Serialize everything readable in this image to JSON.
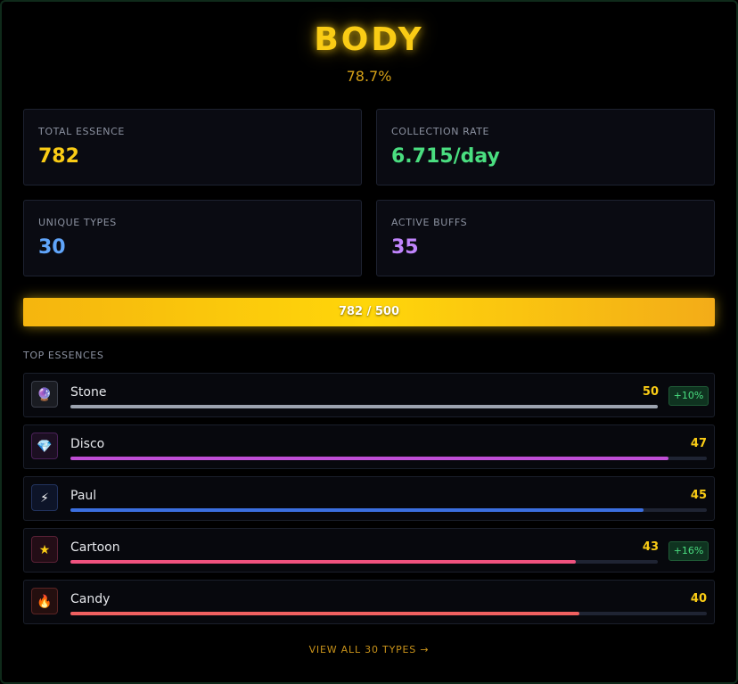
{
  "header": {
    "title": "BODY",
    "subtitle": "78.7%"
  },
  "stats": {
    "total_essence": {
      "label": "TOTAL ESSENCE",
      "value": "782",
      "color": "#facc15"
    },
    "collection_rate": {
      "label": "COLLECTION RATE",
      "value": "6.715/day",
      "color": "#4ade80"
    },
    "unique_types": {
      "label": "UNIQUE TYPES",
      "value": "30",
      "color": "#60a5fa"
    },
    "active_buffs": {
      "label": "ACTIVE BUFFS",
      "value": "35",
      "color": "#c084fc"
    }
  },
  "progress": {
    "text": "782 / 500",
    "fraction": 1.0
  },
  "top_essences": {
    "label": "TOP ESSENCES",
    "items": [
      {
        "name": "Stone",
        "count": "50",
        "bar_fraction": 1.0,
        "color": "#9ca3af",
        "icon": "crystal-ball-icon",
        "glyph": "🔮",
        "icon_bg": "#1a1c22",
        "icon_border": "#3b3f4a",
        "badge": "+10%"
      },
      {
        "name": "Disco",
        "count": "47",
        "bar_fraction": 0.94,
        "color": "#c04ed6",
        "icon": "gem-icon",
        "glyph": "💎",
        "icon_bg": "#1c0f22",
        "icon_border": "#4a2158",
        "badge": null
      },
      {
        "name": "Paul",
        "count": "45",
        "bar_fraction": 0.9,
        "color": "#3b6fe0",
        "icon": "lightning-icon",
        "glyph": "⚡",
        "icon_bg": "#0d1428",
        "icon_border": "#22335e",
        "badge": null
      },
      {
        "name": "Cartoon",
        "count": "43",
        "bar_fraction": 0.86,
        "color": "#f0527f",
        "icon": "star-icon",
        "glyph": "★",
        "icon_bg": "#230d16",
        "icon_border": "#5a2136",
        "badge": "+16%"
      },
      {
        "name": "Candy",
        "count": "40",
        "bar_fraction": 0.8,
        "color": "#f06060",
        "icon": "fire-icon",
        "glyph": "🔥",
        "icon_bg": "#240f0f",
        "icon_border": "#5a2424",
        "badge": null
      }
    ]
  },
  "footer": {
    "view_all": "VIEW ALL 30 TYPES →"
  }
}
